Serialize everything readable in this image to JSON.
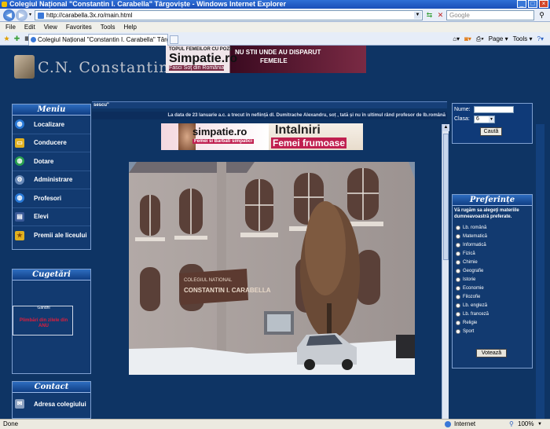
{
  "window": {
    "title": "Colegiul Național \"Constantin I. Carabella\" Târgoviște - Windows Internet Explorer",
    "tab_title": "Colegiul Național \"Constantin I. Carabella\" Târgoviște",
    "address": "http://carabella.3x.ro/main.html",
    "search_placeholder": "Google",
    "menu": [
      "File",
      "Edit",
      "View",
      "Favorites",
      "Tools",
      "Help"
    ],
    "commands": [
      "Page ▾",
      "Tools ▾"
    ]
  },
  "site": {
    "logo_text": "C.N. Constantin Carab",
    "ad_top": {
      "line1": "TOPUL FEMEILOR CU POZE",
      "brand": "Simpatie.ro",
      "line2": "NU STII UNDE AU DISPARUT",
      "line3": "FEMEILE",
      "tagline": "Fasci Soţ din România"
    },
    "ad_center": {
      "brand": "simpatie.ro",
      "sub": "Femei si Barbati simpatici",
      "title": "Intalniri",
      "sub2": "Femei frumoase"
    },
    "strip_text": "sescu\"",
    "news_ticker": "La data de 23 Ianuarie a.c. a trecut în neființă dl. Dumitrache Alexandru, soț , tată și nu în ultimul rând profesor de lb.română",
    "menu_panel": {
      "title": "Meniu",
      "items": [
        {
          "label": "Localizare",
          "icon": "globe-icon"
        },
        {
          "label": "Conducere",
          "icon": "folder-icon"
        },
        {
          "label": "Dotare",
          "icon": "globe-icon"
        },
        {
          "label": "Administrare",
          "icon": "gear-icon"
        },
        {
          "label": "Profesori",
          "icon": "globe-icon"
        },
        {
          "label": "Elevi",
          "icon": "book-icon"
        },
        {
          "label": "Premii ale liceului",
          "icon": "star-icon"
        }
      ]
    },
    "cugetari": {
      "title": "Cugetări",
      "author": "Gandhi",
      "quote": "Plimbări din zilele din ANU"
    },
    "contact": {
      "title": "Contact",
      "item": "Adresa colegiului"
    },
    "search_form": {
      "nume_label": "Nume:",
      "clasa_label": "Clasa:",
      "clasa_value": "6",
      "button": "Caută"
    },
    "preferinte": {
      "title": "Preferințe",
      "intro": "Vă rugăm sa alegeţi materiile dumneavoastră preferate.",
      "options": [
        "Lb. română",
        "Matematică",
        "Informatică",
        "Fizică",
        "Chimie",
        "Geografie",
        "Istorie",
        "Economie",
        "Filozofie",
        "Lb. engleză",
        "Lb. franceză",
        "Religie",
        "Sport"
      ],
      "button": "Votează"
    },
    "photo_sign": "COLEGIUL NAŢIONAL CONSTANTIN I. CARABELLA TÂRGOVIŞTE"
  },
  "status": {
    "left": "Done",
    "zone": "Internet",
    "zoom": "100%"
  }
}
